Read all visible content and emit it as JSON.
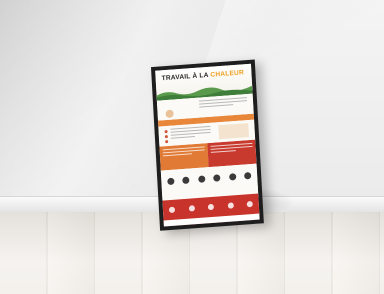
{
  "poster": {
    "title_main": "TRAVAIL À LA",
    "title_accent": "CHALEUR"
  },
  "colors": {
    "frame": "#1e1e1e",
    "accent_orange": "#e8863a",
    "accent_red": "#c8332b",
    "title_yellow": "#f0a020"
  }
}
